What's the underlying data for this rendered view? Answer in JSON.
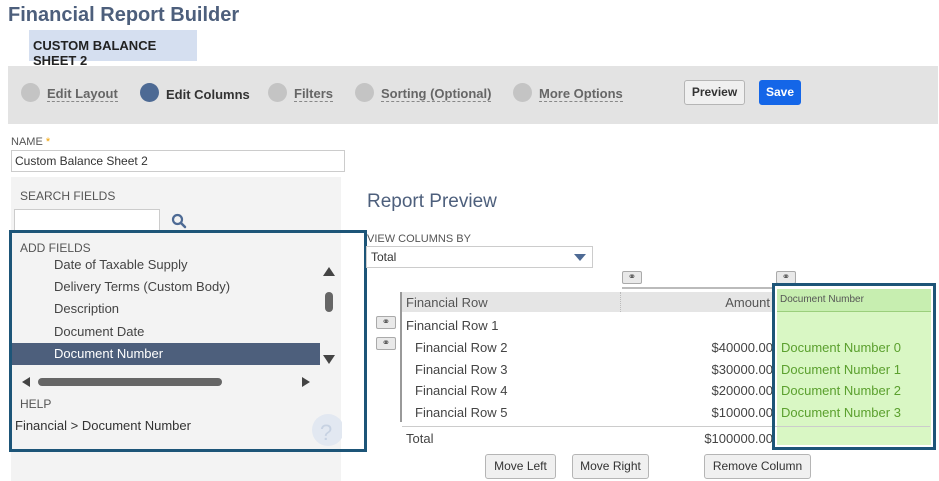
{
  "app": {
    "title": "Financial Report Builder",
    "subtitle_tab": "CUSTOM BALANCE SHEET 2"
  },
  "steps": [
    {
      "label": "Edit Layout",
      "active": false
    },
    {
      "label": "Edit Columns",
      "active": true
    },
    {
      "label": "Filters",
      "active": false
    },
    {
      "label": "Sorting (Optional)",
      "active": false
    },
    {
      "label": "More Options",
      "active": false
    }
  ],
  "toolbar": {
    "preview_label": "Preview",
    "save_label": "Save"
  },
  "name_field": {
    "label": "NAME",
    "required_mark": "*",
    "value": "Custom Balance Sheet 2"
  },
  "left_panel": {
    "search_label": "SEARCH FIELDS",
    "add_fields_label": "ADD FIELDS",
    "fields": [
      "Date of Taxable Supply",
      "Delivery Terms (Custom Body)",
      "Description",
      "Document Date",
      "Document Number"
    ],
    "selected_field": "Document Number",
    "help_label": "HELP",
    "help_path": "Financial > Document Number"
  },
  "preview": {
    "title": "Report Preview",
    "view_columns_label": "VIEW COLUMNS BY",
    "view_columns_value": "Total",
    "headers": {
      "row": "Financial Row",
      "amount": "Amount",
      "docnum": "Document Number"
    },
    "group_row": "Financial Row 1",
    "rows": [
      {
        "label": "Financial Row 2",
        "amount": "$40000.00",
        "docnum": "Document Number 0"
      },
      {
        "label": "Financial Row 3",
        "amount": "$30000.00",
        "docnum": "Document Number 1"
      },
      {
        "label": "Financial Row 4",
        "amount": "$20000.00",
        "docnum": "Document Number 2"
      },
      {
        "label": "Financial Row 5",
        "amount": "$10000.00",
        "docnum": "Document Number 3"
      }
    ],
    "total_label": "Total",
    "total_amount": "$100000.00"
  },
  "column_actions": {
    "move_left": "Move Left",
    "move_right": "Move Right",
    "remove": "Remove Column"
  },
  "icons": {
    "link": "link-icon",
    "search": "search-icon"
  },
  "colors": {
    "accent": "#1466e8",
    "title": "#4d5f7c",
    "highlight": "#d9f7c4",
    "doc_text": "#5ba02e"
  }
}
